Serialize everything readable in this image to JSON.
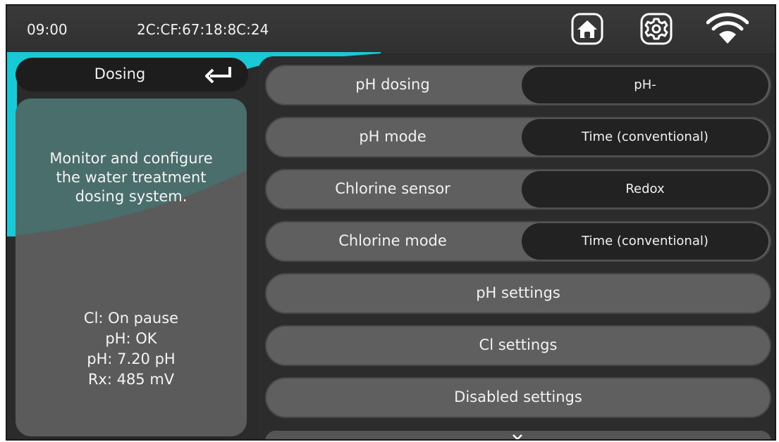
{
  "status_bar": {
    "time": "09:00",
    "mac_address": "2C:CF:67:18:8C:24",
    "icons": [
      "home-icon",
      "gear-icon",
      "wifi-icon"
    ]
  },
  "colors": {
    "accent": "#19c9d6",
    "panel": "#5b5b5b",
    "panel_teal": "#4a6e6c",
    "pill_dark": "#222222",
    "row": "#5f5f5f"
  },
  "sidebar": {
    "title": "Dosing",
    "description": [
      "Monitor and configure",
      "the water treatment",
      "dosing system."
    ],
    "status": [
      "Cl: On pause",
      "pH: OK",
      "pH: 7.20 pH",
      "Rx: 485 mV"
    ]
  },
  "menu": {
    "rows": [
      {
        "label": "pH dosing",
        "value": "pH-"
      },
      {
        "label": "pH mode",
        "value": "Time (conventional)"
      },
      {
        "label": "Chlorine sensor",
        "value": "Redox"
      },
      {
        "label": "Chlorine mode",
        "value": "Time (conventional)"
      }
    ],
    "buttons": [
      "pH settings",
      "Cl settings",
      "Disabled settings"
    ]
  }
}
